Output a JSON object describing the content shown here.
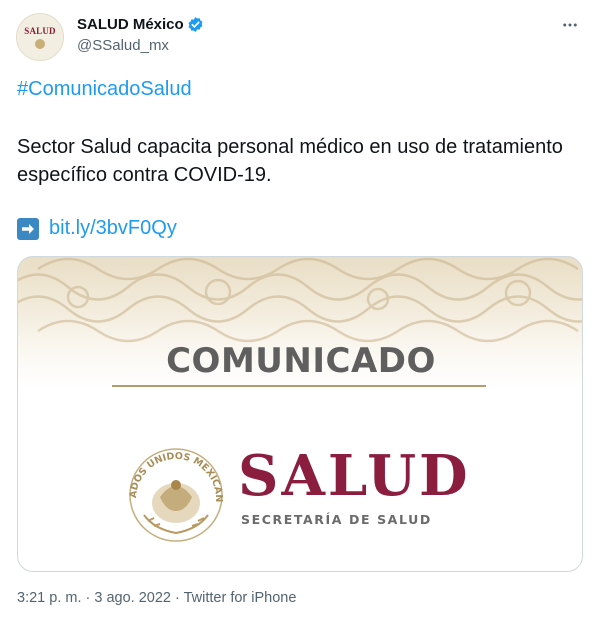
{
  "account": {
    "avatar_text": "SALUD",
    "display_name": "SALUD México",
    "handle": "@SSalud_mx"
  },
  "tweet": {
    "hashtag": "#ComunicadoSalud",
    "text": "Sector Salud capacita personal médico en uso de tratamiento específico contra COVID-19.",
    "link": "bit.ly/3bvF0Qy"
  },
  "media": {
    "heading": "COMUNICADO",
    "seal_text": "ESTADOS UNIDOS MEXICANOS",
    "brand": "SALUD",
    "subtitle": "SECRETARÍA DE SALUD"
  },
  "footer": {
    "time": "3:21 p. m.",
    "separator1": " · ",
    "date": "3 ago. 2022",
    "separator2": " · ",
    "source": "Twitter for iPhone"
  },
  "colors": {
    "link": "#1d9bf0",
    "verified": "#1d9bf0",
    "brand": "#8b1e3f",
    "gold": "#b59b6a"
  },
  "icons": [
    "verified-badge-icon",
    "more-options-icon",
    "right-arrow-icon"
  ]
}
